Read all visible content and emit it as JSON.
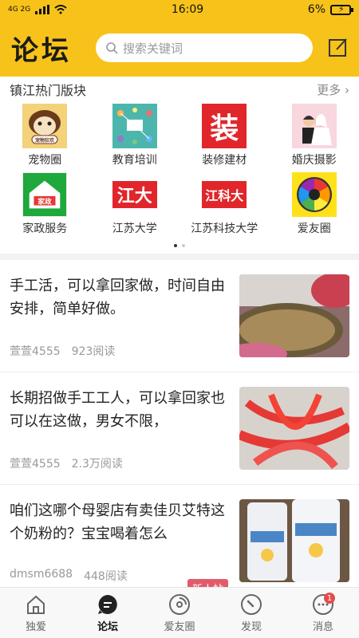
{
  "status_bar": {
    "network": "4G 2G",
    "time": "16:09",
    "battery": "6%"
  },
  "header": {
    "logo": "论坛",
    "search_placeholder": "搜索关键词"
  },
  "hot_section": {
    "title": "镇江热门版块",
    "more": "更多"
  },
  "boards": [
    {
      "label": "宠物圈",
      "icon": "pet-icon",
      "tile_text": "宠物狂欢"
    },
    {
      "label": "教育培训",
      "icon": "education-icon"
    },
    {
      "label": "装修建材",
      "icon": "decoration-icon",
      "tile_text": "装"
    },
    {
      "label": "婚庆摄影",
      "icon": "wedding-icon"
    },
    {
      "label": "家政服务",
      "icon": "housekeeping-icon",
      "tile_text": "家政"
    },
    {
      "label": "江苏大学",
      "icon": "jiangsu-university-icon",
      "tile_text": "江大"
    },
    {
      "label": "江苏科技大学",
      "icon": "just-icon",
      "tile_text": "江科大"
    },
    {
      "label": "爱友圈",
      "icon": "camera-aperture-icon"
    }
  ],
  "posts": [
    {
      "title": "手工活，可以拿回家做，时间自由安排，简单好做。",
      "author": "萱萱4555",
      "reads": "923阅读"
    },
    {
      "title": "长期招做手工工人，可以拿回家也可以在这做，男女不限，",
      "author": "萱萱4555",
      "reads": "2.3万阅读"
    },
    {
      "title": "咱们这哪个母婴店有卖佳贝艾特这个奶粉的？宝宝喝着怎么",
      "author": "dmsm6688",
      "reads": "448阅读",
      "badge": "新人帖"
    }
  ],
  "tabs": [
    {
      "label": "独爱",
      "icon": "home-icon"
    },
    {
      "label": "论坛",
      "icon": "forum-icon"
    },
    {
      "label": "爱友圈",
      "icon": "disc-icon"
    },
    {
      "label": "发现",
      "icon": "compass-icon"
    },
    {
      "label": "消息",
      "icon": "message-icon",
      "badge": "1"
    }
  ],
  "colors": {
    "brand": "#f7c21a",
    "badge": "#e54b4b",
    "new_post": "#e25b6a"
  }
}
